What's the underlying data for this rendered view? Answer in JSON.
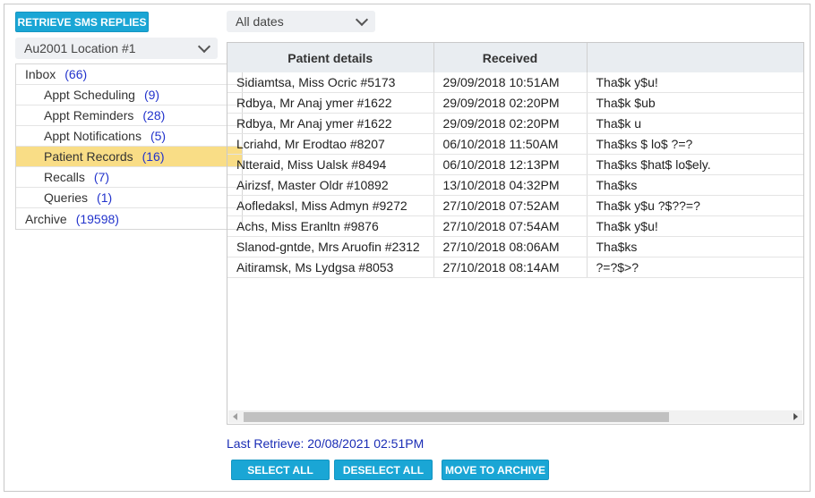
{
  "toolbar": {
    "retrieve_label": "RETRIEVE SMS REPLIES",
    "date_filter": "All dates",
    "location": "Au2001 Location #1"
  },
  "folders": [
    {
      "label": "Inbox",
      "count": "(66)"
    },
    {
      "label": "Appt Scheduling",
      "count": "(9)"
    },
    {
      "label": "Appt Reminders",
      "count": "(28)"
    },
    {
      "label": "Appt Notifications",
      "count": "(5)"
    },
    {
      "label": "Patient Records",
      "count": "(16)"
    },
    {
      "label": "Recalls",
      "count": "(7)"
    },
    {
      "label": "Queries",
      "count": "(1)"
    },
    {
      "label": "Archive",
      "count": "(19598)"
    }
  ],
  "table": {
    "columns": [
      "Patient details",
      "Received",
      ""
    ],
    "rows": [
      [
        "Sidiamtsa, Miss Ocric #5173",
        "29/09/2018 10:51AM",
        "Tha$k y$u!"
      ],
      [
        "Rdbya, Mr Anaj ymer #1622",
        "29/09/2018 02:20PM",
        "Tha$k $ub"
      ],
      [
        "Rdbya, Mr Anaj ymer #1622",
        "29/09/2018 02:20PM",
        "Tha$k u"
      ],
      [
        "Lcriahd, Mr Erodtao #8207",
        "06/10/2018 11:50AM",
        "Tha$ks $ lo$ ?=?"
      ],
      [
        "Ntteraid, Miss Ualsk #8494",
        "06/10/2018 12:13PM",
        "Tha$ks $hat$ lo$ely."
      ],
      [
        "Airizsf, Master Oldr #10892",
        "13/10/2018 04:32PM",
        "Tha$ks"
      ],
      [
        "Aofledaksl, Miss Admyn #9272",
        "27/10/2018 07:52AM",
        "Tha$k y$u ?$??=?"
      ],
      [
        "Achs, Miss Eranltn #9876",
        "27/10/2018 07:54AM",
        "Tha$k y$u!"
      ],
      [
        "Slanod-gntde, Mrs Aruofin #2312",
        "27/10/2018 08:06AM",
        "Tha$ks"
      ],
      [
        "Aitiramsk, Ms Lydgsa #8053",
        "27/10/2018 08:14AM",
        "?=?$>?"
      ]
    ]
  },
  "status": {
    "last_retrieve": "Last Retrieve: 20/08/2021 02:51PM"
  },
  "actions": {
    "select_all": "SELECT ALL",
    "deselect_all": "DESELECT ALL",
    "move_to_archive": "MOVE TO ARCHIVE"
  },
  "colors": {
    "accent": "#1aa6d5",
    "active_folder": "#f9dd86",
    "count": "#2233cc",
    "status_text": "#1a2db5"
  }
}
